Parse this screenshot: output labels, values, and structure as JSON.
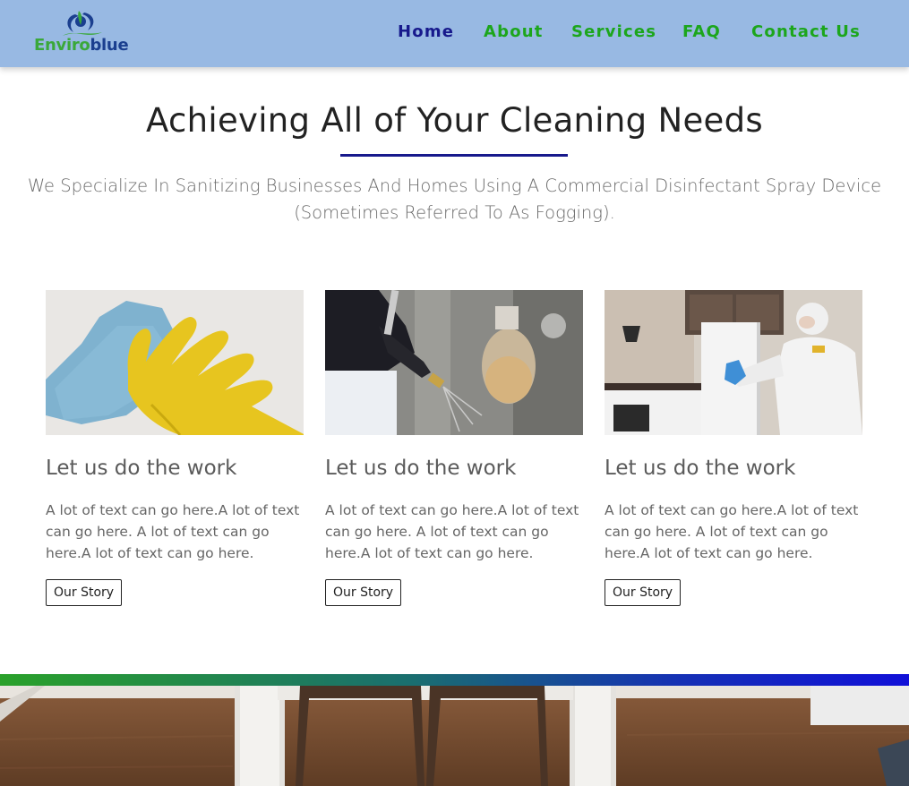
{
  "header": {
    "logo": {
      "text_green": "Enviro",
      "text_blue": "blue"
    },
    "nav": [
      {
        "label": "Home",
        "active": true
      },
      {
        "label": "About",
        "active": false
      },
      {
        "label": "Services",
        "active": false
      },
      {
        "label": "FAQ",
        "active": false
      },
      {
        "label": "Contact Us",
        "active": false
      }
    ]
  },
  "hero": {
    "title": "Achieving All of Your Cleaning Needs",
    "subtitle": "We Specialize In Sanitizing Businesses And Homes Using A Commercial Disinfectant Spray Device (Sometimes Referred To As Fogging)."
  },
  "cards": [
    {
      "image": "yellow-glove-cleaning-photo",
      "title": "Let us do the work",
      "text": "A lot of text can go here.A lot of text can go here. A lot of text can go here.A lot of text can go here.",
      "button": "Our Story"
    },
    {
      "image": "disinfectant-spray-photo",
      "title": "Let us do the work",
      "text": "A lot of text can go here.A lot of text can go here. A lot of text can go here.A lot of text can go here.",
      "button": "Our Story"
    },
    {
      "image": "hazmat-kitchen-cleaning-photo",
      "title": "Let us do the work",
      "text": "A lot of text can go here.A lot of text can go here. A lot of text can go here.A lot of text can go here.",
      "button": "Our Story"
    }
  ],
  "colors": {
    "header_bg": "#98b9e3",
    "nav_active": "#17198c",
    "nav_link": "#1ca61c",
    "divider": "#17198c",
    "gradient_start": "#2aa12a",
    "gradient_end": "#1110d8"
  }
}
